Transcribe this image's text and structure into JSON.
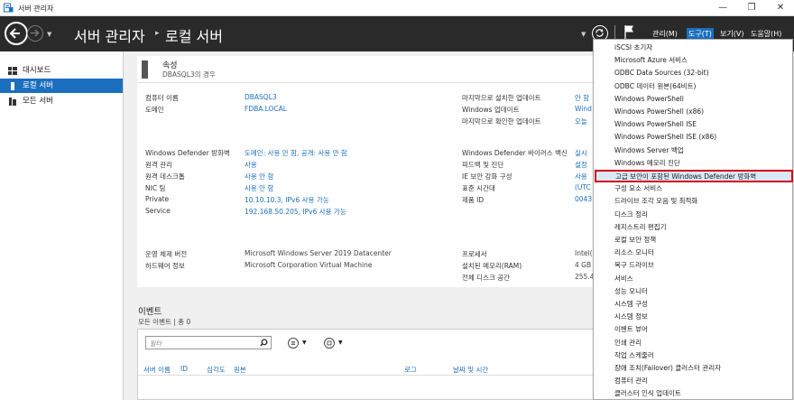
{
  "window": {
    "title": "서버 관리자",
    "buttons": [
      "—",
      "❐",
      "✕"
    ]
  },
  "header": {
    "breadcrumb": [
      "서버 관리자",
      "로컬 서버"
    ],
    "menus": [
      {
        "label": "관리(M)",
        "active": false
      },
      {
        "label": "도구(T)",
        "active": true
      },
      {
        "label": "보기(V)",
        "active": false
      },
      {
        "label": "도움말(H)",
        "active": false
      }
    ]
  },
  "sidebar": {
    "items": [
      {
        "label": "대시보드",
        "icon": "dashboard-icon",
        "active": false
      },
      {
        "label": "로컬 서버",
        "icon": "server-icon",
        "active": true
      },
      {
        "label": "모든 서버",
        "icon": "servers-icon",
        "active": false
      }
    ]
  },
  "properties": {
    "title": "속성",
    "subtitle": "DBASQL3의 경우",
    "left_group1": [
      {
        "label": "컴퓨터 이름",
        "value": "DBASQL3"
      },
      {
        "label": "도메인",
        "value": "FDBA.LOCAL"
      }
    ],
    "right_group1": [
      {
        "label": "마지막으로 설치한 업데이트",
        "value": "안 함"
      },
      {
        "label": "Windows 업데이트",
        "value": "Wind"
      },
      {
        "label": "마지막으로 확인한 업데이트",
        "value": "오늘"
      }
    ],
    "left_group2": [
      {
        "label": "Windows Defender 방화벽",
        "value": "도메인: 사용 안 함, 공개: 사용 안 함"
      },
      {
        "label": "원격 관리",
        "value": "사용"
      },
      {
        "label": "원격 데스크톱",
        "value": "사용 안 함"
      },
      {
        "label": "NIC 팀",
        "value": "사용 안 함"
      },
      {
        "label": "Private",
        "value": "10.10.10.3, IPv6 사용 가능"
      },
      {
        "label": "Service",
        "value": "192.168.50.205, IPv6 사용 가능"
      }
    ],
    "right_group2": [
      {
        "label": "Windows Defender 바이러스 백신",
        "value": "실시"
      },
      {
        "label": "피드백 및 진단",
        "value": "설정"
      },
      {
        "label": "IE 보안 강화 구성",
        "value": "사용"
      },
      {
        "label": "표준 시간대",
        "value": "(UTC"
      },
      {
        "label": "제품 ID",
        "value": "0043"
      }
    ],
    "left_group3": [
      {
        "label": "운영 체제 버전",
        "value": "Microsoft Windows Server 2019 Datacenter"
      },
      {
        "label": "하드웨어 정보",
        "value": "Microsoft Corporation Virtual Machine"
      }
    ],
    "right_group3": [
      {
        "label": "프로세서",
        "value": "Intel("
      },
      {
        "label": "설치된 메모리(RAM)",
        "value": "4 GB"
      },
      {
        "label": "전체 디스크 공간",
        "value": "255.4"
      }
    ]
  },
  "events": {
    "title": "이벤트",
    "subtitle": "모든 이벤트 | 총 0",
    "filter_placeholder": "필터",
    "columns": [
      "서버 이름",
      "ID",
      "심각도",
      "원본",
      "로그",
      "날짜 및 시간"
    ]
  },
  "tools_menu": {
    "items": [
      "iSCSI 초기자",
      "Microsoft Azure 서비스",
      "ODBC Data Sources (32-bit)",
      "ODBC 데이터 원본(64비트)",
      "Windows PowerShell",
      "Windows PowerShell (x86)",
      "Windows PowerShell ISE",
      "Windows PowerShell ISE (x86)",
      "Windows Server 백업",
      "Windows 메모리 진단",
      "고급 보안이 포함된 Windows Defender 방화벽",
      "구성 요소 서비스",
      "드라이브 조각 모음 및 최적화",
      "디스크 정리",
      "레지스트리 편집기",
      "로컬 보안 정책",
      "리소스 모니터",
      "복구 드라이브",
      "서비스",
      "성능 모니터",
      "시스템 구성",
      "시스템 정보",
      "이벤트 뷰어",
      "인쇄 관리",
      "작업 스케줄러",
      "장애 조치(Failover) 클러스터 관리자",
      "컴퓨터 관리",
      "클러스터 인식 업데이트"
    ],
    "highlighted_index": 10,
    "highlight_color": "#d0021b"
  }
}
